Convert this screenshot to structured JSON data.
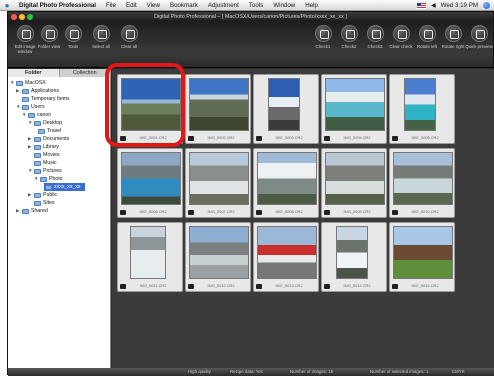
{
  "menubar": {
    "app_name": "Digital Photo Professional",
    "menus": [
      "File",
      "Edit",
      "View",
      "Bookmark",
      "Adjustment",
      "Tools",
      "Window",
      "Help"
    ],
    "clock": "Wed 3:19 PM"
  },
  "window": {
    "title": "Digital Photo Professional – [ MacOSX/Users/canon/Pictures/Photo/xxxx_xx_xx ]"
  },
  "toolbar": {
    "buttons_left": [
      "Edit image window",
      "Folder view",
      "Tools",
      "Select all",
      "Clear all"
    ],
    "buttons_right": [
      "Check1",
      "Check2",
      "Check3",
      "Clear check",
      "Rotate left",
      "Rotate right",
      "Quick preview"
    ]
  },
  "sidebar": {
    "tabs": [
      "Folder",
      "Collection"
    ],
    "tree": [
      {
        "label": "MacOSX",
        "level": 0,
        "expanded": true
      },
      {
        "label": "Applications",
        "level": 1
      },
      {
        "label": "Temporary Items",
        "level": 1
      },
      {
        "label": "Users",
        "level": 1,
        "expanded": true
      },
      {
        "label": "canon",
        "level": 2,
        "expanded": true
      },
      {
        "label": "Desktop",
        "level": 3,
        "expanded": true
      },
      {
        "label": "Travel",
        "level": 4
      },
      {
        "label": "Documents",
        "level": 3
      },
      {
        "label": "Library",
        "level": 3
      },
      {
        "label": "Movies",
        "level": 3
      },
      {
        "label": "Music",
        "level": 3
      },
      {
        "label": "Pictures",
        "level": 3,
        "expanded": true
      },
      {
        "label": "Photo",
        "level": 4,
        "expanded": true
      },
      {
        "label": "xxxx_xx_xx",
        "level": 5,
        "selected": true
      },
      {
        "label": "Public",
        "level": 3
      },
      {
        "label": "Sites",
        "level": 3
      },
      {
        "label": "Shared",
        "level": 1
      }
    ]
  },
  "thumbnails": [
    {
      "caption": "IMG_0001.CR2",
      "scene": "mountain-sky"
    },
    {
      "caption": "IMG_0002.CR2",
      "scene": "mountain-valley"
    },
    {
      "caption": "IMG_0003.CR2",
      "scene": "peak-portrait"
    },
    {
      "caption": "IMG_0004.CR2",
      "scene": "lake-turquoise"
    },
    {
      "caption": "IMG_0005.CR2",
      "scene": "lake-portrait"
    },
    {
      "caption": "IMG_0006.CR2",
      "scene": "lake-blue"
    },
    {
      "caption": "IMG_0007.CR2",
      "scene": "glacier"
    },
    {
      "caption": "IMG_0008.CR2",
      "scene": "glacier-peak"
    },
    {
      "caption": "IMG_0009.CR2",
      "scene": "glacier-valley"
    },
    {
      "caption": "IMG_0010.CR2",
      "scene": "glacier-lake"
    },
    {
      "caption": "IMG_0011.CR2",
      "scene": "ice-field"
    },
    {
      "caption": "IMG_0012.CR2",
      "scene": "snowcoach"
    },
    {
      "caption": "IMG_0013.CR2",
      "scene": "snowcoach-road"
    },
    {
      "caption": "IMG_0014.CR2",
      "scene": "waterfall"
    },
    {
      "caption": "IMG_0015.CR2",
      "scene": "lodge"
    }
  ],
  "status": {
    "quality": "High quality",
    "recipe": "Recipe data: Yes",
    "count": "Number of images: 15",
    "selected": "Number of selected images: 1",
    "color": "CMYK"
  },
  "colors": {
    "highlight": "#e01818",
    "selection": "#3a6fd1"
  }
}
